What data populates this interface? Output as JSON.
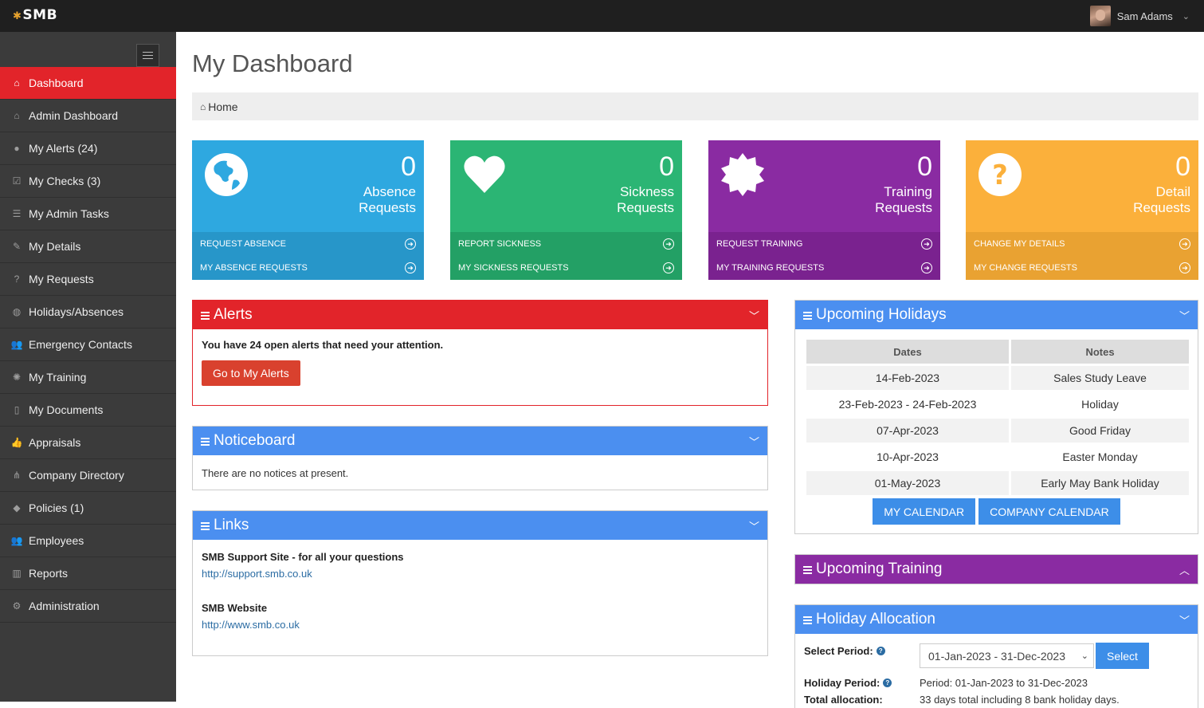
{
  "app": {
    "logo": "SMB",
    "user_name": "Sam Adams"
  },
  "sidebar": {
    "items": [
      {
        "label": "Dashboard",
        "icon": "home-icon",
        "active": true
      },
      {
        "label": "Admin Dashboard",
        "icon": "home-icon"
      },
      {
        "label": "My Alerts (24)",
        "icon": "exclamation-icon"
      },
      {
        "label": "My Checks (3)",
        "icon": "check-square-icon"
      },
      {
        "label": "My Admin Tasks",
        "icon": "list-icon"
      },
      {
        "label": "My Details",
        "icon": "edit-icon"
      },
      {
        "label": "My Requests",
        "icon": "question-icon"
      },
      {
        "label": "Holidays/Absences",
        "icon": "globe-icon"
      },
      {
        "label": "Emergency Contacts",
        "icon": "users-icon"
      },
      {
        "label": "My Training",
        "icon": "certificate-icon"
      },
      {
        "label": "My Documents",
        "icon": "file-icon"
      },
      {
        "label": "Appraisals",
        "icon": "thumbs-up-icon"
      },
      {
        "label": "Company Directory",
        "icon": "sitemap-icon"
      },
      {
        "label": "Policies (1)",
        "icon": "tags-icon"
      },
      {
        "label": "Employees",
        "icon": "users-icon"
      },
      {
        "label": "Reports",
        "icon": "bar-chart-icon"
      },
      {
        "label": "Administration",
        "icon": "cogs-icon"
      }
    ]
  },
  "page": {
    "title": "My Dashboard",
    "breadcrumb": "Home"
  },
  "tiles": [
    {
      "count": "0",
      "label1": "Absence",
      "label2": "Requests",
      "link1": "REQUEST ABSENCE",
      "link2": "MY ABSENCE REQUESTS",
      "icon": "globe-icon",
      "color": "#2ea8e0"
    },
    {
      "count": "0",
      "label1": "Sickness",
      "label2": "Requests",
      "link1": "REPORT SICKNESS",
      "link2": "MY SICKNESS REQUESTS",
      "icon": "heart-icon",
      "color": "#2bb574"
    },
    {
      "count": "0",
      "label1": "Training",
      "label2": "Requests",
      "link1": "REQUEST TRAINING",
      "link2": "MY TRAINING REQUESTS",
      "icon": "certificate-icon",
      "color": "#8a2ba2"
    },
    {
      "count": "0",
      "label1": "Detail",
      "label2": "Requests",
      "link1": "CHANGE MY DETAILS",
      "link2": "MY CHANGE REQUESTS",
      "icon": "question-icon",
      "color": "#fbb03b"
    }
  ],
  "alerts": {
    "title": "Alerts",
    "message": "You have 24 open alerts that need your attention.",
    "button": "Go to My Alerts"
  },
  "noticeboard": {
    "title": "Noticeboard",
    "message": "There are no notices at present."
  },
  "links": {
    "title": "Links",
    "items": [
      {
        "title": "SMB Support Site - for all your questions",
        "url": "http://support.smb.co.uk"
      },
      {
        "title": "SMB Website",
        "url": "http://www.smb.co.uk"
      }
    ]
  },
  "holidays": {
    "title": "Upcoming Holidays",
    "headers": [
      "Dates",
      "Notes"
    ],
    "rows": [
      [
        "14-Feb-2023",
        "Sales Study Leave"
      ],
      [
        "23-Feb-2023 - 24-Feb-2023",
        "Holiday"
      ],
      [
        "07-Apr-2023",
        "Good Friday"
      ],
      [
        "10-Apr-2023",
        "Easter Monday"
      ],
      [
        "01-May-2023",
        "Early May Bank Holiday"
      ]
    ],
    "btn_my_calendar": "MY CALENDAR",
    "btn_company_calendar": "COMPANY CALENDAR"
  },
  "training": {
    "title": "Upcoming Training"
  },
  "allocation": {
    "title": "Holiday Allocation",
    "select_label": "Select Period:",
    "select_value": "01-Jan-2023 - 31-Dec-2023",
    "select_button": "Select",
    "period_label": "Holiday Period:",
    "period_value": "Period: 01-Jan-2023 to 31-Dec-2023",
    "total_label": "Total allocation:",
    "total_value": "33 days total including 8 bank holiday days."
  }
}
